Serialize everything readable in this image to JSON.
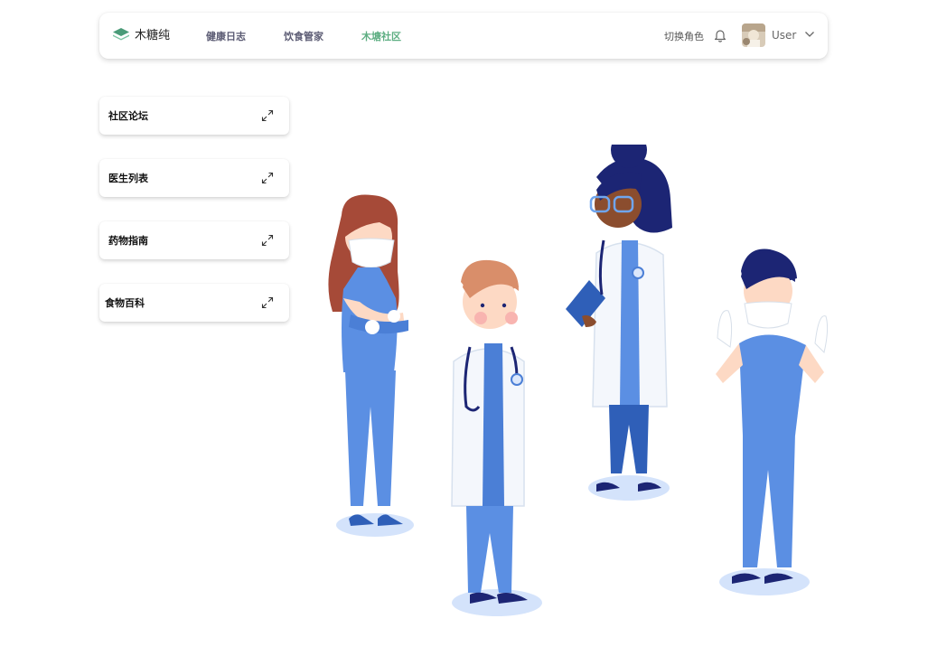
{
  "brand": {
    "name": "木糖纯",
    "icon": "layers-logo-icon",
    "color": "#4a9b78"
  },
  "nav": {
    "links": [
      {
        "label": "健康日志",
        "active": false
      },
      {
        "label": "饮食管家",
        "active": false
      },
      {
        "label": "木塘社区",
        "active": true
      }
    ],
    "active_color": "#5dae82"
  },
  "header": {
    "switch_role": "切换角色",
    "bell_icon": "bell-icon",
    "user": {
      "name": "User",
      "avatar": "user-avatar",
      "caret_icon": "chevron-down-icon"
    }
  },
  "cards": [
    {
      "label": "社区论坛",
      "icon": "expand-icon"
    },
    {
      "label": "医生列表",
      "icon": "expand-icon"
    },
    {
      "label": "药物指南",
      "icon": "expand-icon"
    },
    {
      "label": "食物百科",
      "icon": "expand-icon"
    }
  ],
  "illustration": {
    "name": "medical-team-illustration"
  },
  "colors": {
    "scrubs": "#5b8fe3",
    "scrubs_dark": "#2f5fb8",
    "navy": "#1c2574",
    "coat": "#f4f7fc",
    "skin_light": "#fdd9c4",
    "skin_dark": "#8b4d2e",
    "hair_red": "#a64a38",
    "hair_ginger": "#d98e6a",
    "floor": "#d4e3fb"
  }
}
